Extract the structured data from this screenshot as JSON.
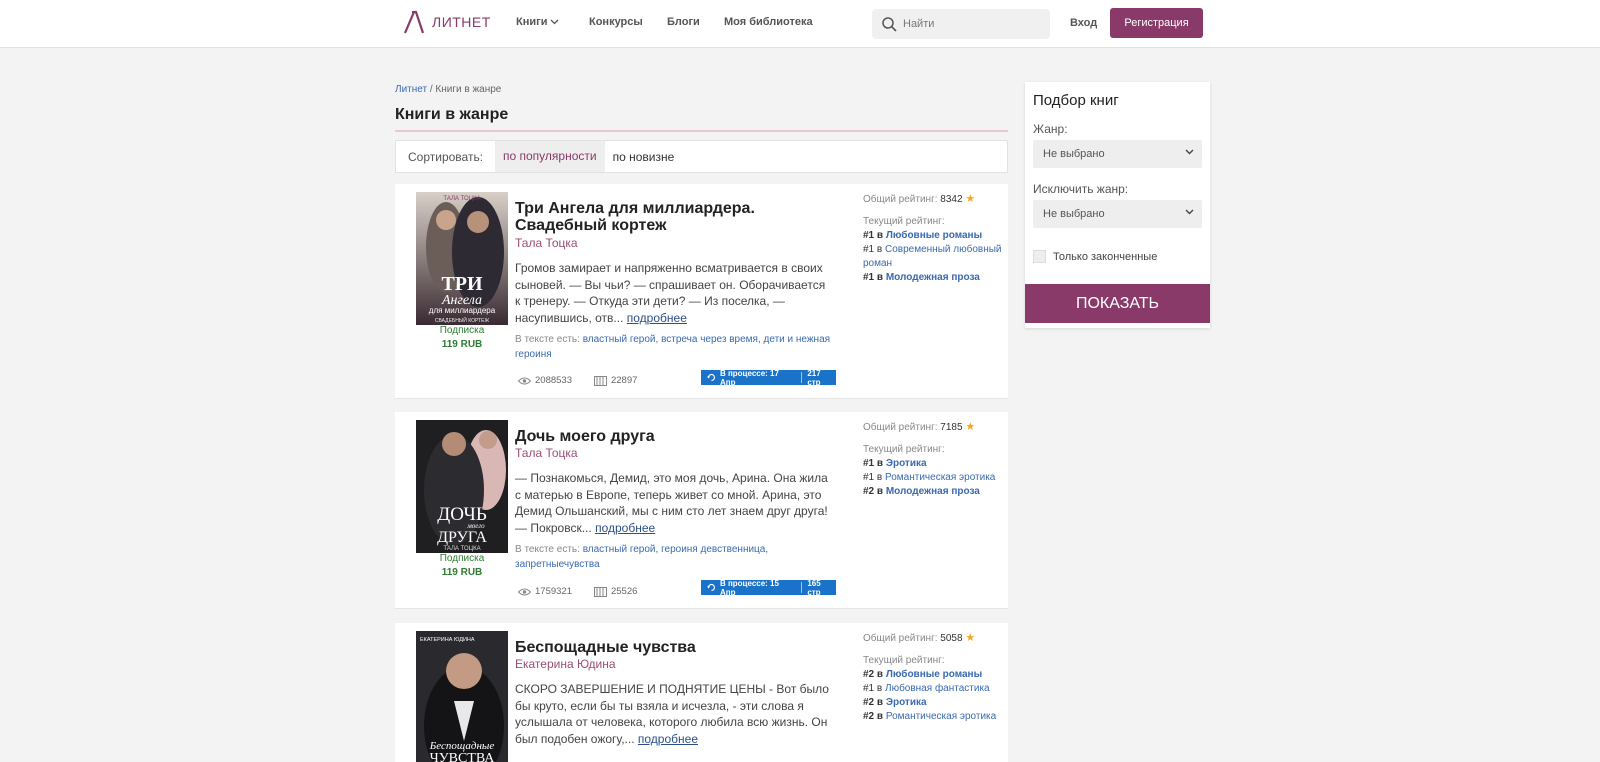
{
  "header": {
    "logo_text": "ЛИТНЕТ",
    "nav": [
      "Книги",
      "Конкурсы",
      "Блоги",
      "Моя библиотека"
    ],
    "search_placeholder": "Найти",
    "login": "Вход",
    "register": "Регистрация"
  },
  "breadcrumb": {
    "home": "Литнет",
    "sep": "/",
    "current": "Книги в жанре"
  },
  "page_title": "Книги в жанре",
  "sort": {
    "label": "Сортировать:",
    "popular": "по популярности",
    "newest": "по новизне"
  },
  "books": [
    {
      "title": "Три Ангела для миллиардера. Свадебный кортеж",
      "author": "Тала Тоцка",
      "subscription": "Подписка",
      "price": "119 RUB",
      "description": "Громов замирает и напряженно всматривается в своих сыновей. — Вы чьи? — спрашивает он. Оборачивается к тренеру. — Откуда эти дети? — Из поселка, — насупившись, отв...",
      "more": "подробнее",
      "tags_label": "В тексте есть:",
      "tags": "властный герой, встреча через время, дети и нежная героиня",
      "views": "2088533",
      "library": "22897",
      "status": "В процессе: 17 Апр",
      "pages": "217 стр",
      "total_label": "Общий рейтинг:",
      "total": "8342",
      "current_label": "Текущий рейтинг:",
      "ranks": [
        {
          "pos": "#1",
          "in": "в",
          "genre": "Любовные романы",
          "bold": true
        },
        {
          "pos": "#1",
          "in": "в",
          "genre": "Современный любовный роман",
          "bold": false
        },
        {
          "pos": "#1",
          "in": "в",
          "genre": "Молодежная проза",
          "bold": true
        }
      ],
      "cover": {
        "top_text": "ТАЛА ТОЦКА",
        "big": "ТРИ",
        "script": "Ангела",
        "line2": "для миллиардера",
        "line3": "СВАДЕБНЫЙ КОРТЕЖ"
      }
    },
    {
      "title": "Дочь моего друга",
      "author": "Тала Тоцка",
      "subscription": "Подписка",
      "price": "119 RUB",
      "description": "— Познакомься, Демид, это моя дочь, Арина. Она жила с матерью в Европе, теперь живет со мной. Арина, это Демид Ольшанский, мы с ним сто лет знаем друг друга! — Покровск...",
      "more": "подробнее",
      "tags_label": "В тексте есть:",
      "tags": "властный герой, героиня девственница, запретныечувства",
      "views": "1759321",
      "library": "25526",
      "status": "В процессе: 15 Апр",
      "pages": "165 стр",
      "total_label": "Общий рейтинг:",
      "total": "7185",
      "current_label": "Текущий рейтинг:",
      "ranks": [
        {
          "pos": "#1",
          "in": "в",
          "genre": "Эротика",
          "bold": true
        },
        {
          "pos": "#1",
          "in": "в",
          "genre": "Романтическая эротика",
          "bold": false
        },
        {
          "pos": "#2",
          "in": "в",
          "genre": "Молодежная проза",
          "bold": true
        }
      ],
      "cover": {
        "top_text": "",
        "big": "ДОЧЬ",
        "script": "моего",
        "line2": "ДРУГА",
        "line3": "ТАЛА ТОЦКА"
      }
    },
    {
      "title": "Беспощадные чувства",
      "author": "Екатерина Юдина",
      "description": "СКОРО ЗАВЕРШЕНИЕ И ПОДНЯТИЕ ЦЕНЫ - Вот было бы круто, если бы ты взяла и исчезла, - эти слова я услышала от человека, которого любила всю жизнь. Он был подобен ожогу,...",
      "more": "подробнее",
      "total_label": "Общий рейтинг:",
      "total": "5058",
      "current_label": "Текущий рейтинг:",
      "ranks": [
        {
          "pos": "#2",
          "in": "в",
          "genre": "Любовные романы",
          "bold": true
        },
        {
          "pos": "#1",
          "in": "в",
          "genre": "Любовная фантастика",
          "bold": false
        },
        {
          "pos": "#2",
          "in": "в",
          "genre": "Эротика",
          "bold": true
        },
        {
          "pos": "#2",
          "in": "в",
          "genre": "Романтическая эротика",
          "bold": false
        }
      ],
      "cover": {
        "top_text": "ЕКАТЕРИНА ЮДИНА",
        "big": "",
        "script": "Беспощадные",
        "line2": "ЧУВСТВА",
        "line3": ""
      }
    }
  ],
  "filter": {
    "title": "Подбор книг",
    "genre_label": "Жанр:",
    "genre_value": "Не выбрано",
    "exclude_label": "Исключить жанр:",
    "exclude_value": "Не выбрано",
    "finished_label": "Только законченные",
    "show_button": "ПОКАЗАТЬ"
  },
  "colors": {
    "brand": "#8a3a68",
    "link": "#3a6ab0",
    "progress": "#1a73c9",
    "price": "#2e7d32",
    "star": "#f5a623"
  }
}
